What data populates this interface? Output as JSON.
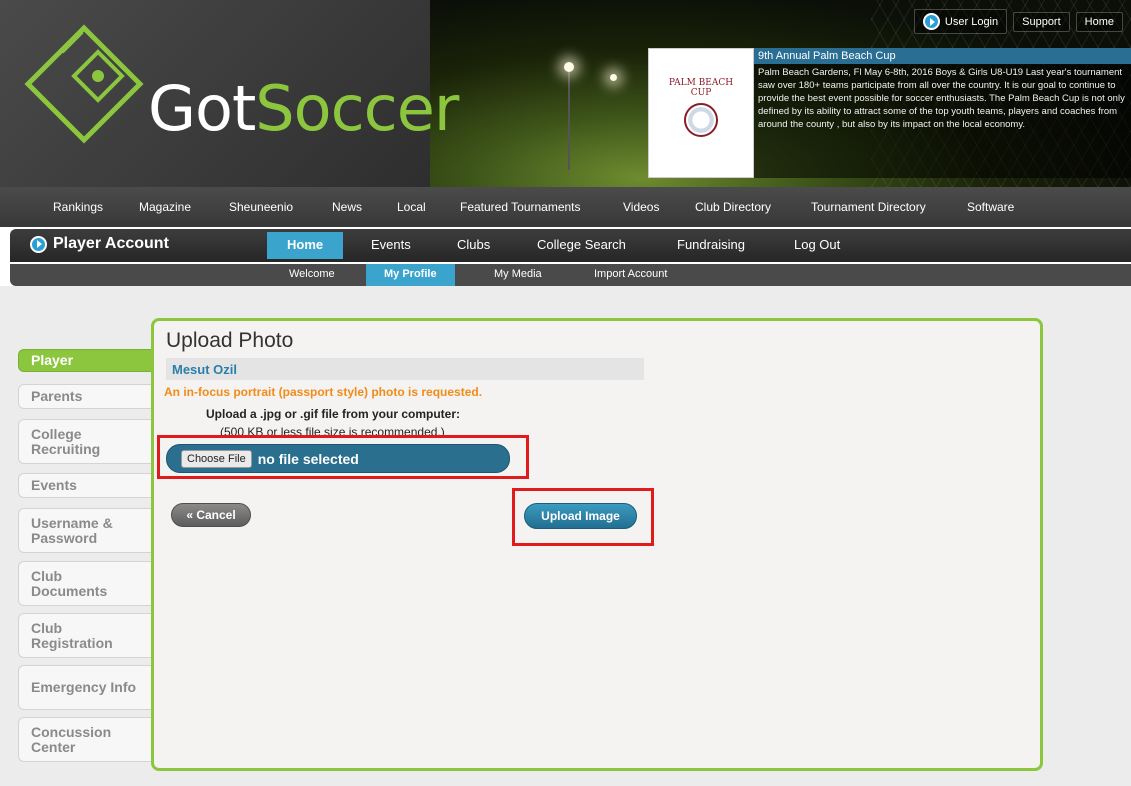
{
  "header": {
    "logo_got": "Got",
    "logo_soccer": "Soccer",
    "top_links": [
      "User Login",
      "Support",
      "Home"
    ]
  },
  "promo": {
    "logo_text_1": "PALM BEACH",
    "logo_text_2": "CUP",
    "title": "9th Annual Palm Beach Cup",
    "body": "Palm Beach Gardens, Fl May 6-8th, 2016 Boys & Girls U8-U19 Last year's tournament saw over 180+ teams participate from all over the country. It is our goal to continue to provide the best event possible for soccer enthusiasts. The Palm Beach Cup is not only defined by its ability to attract some of the top youth teams, players and coaches from around the county , but also by its impact on the local economy."
  },
  "main_nav": [
    "Rankings",
    "Magazine",
    "Sheuneenio",
    "News",
    "Local",
    "Featured Tournaments",
    "Videos",
    "Club Directory",
    "Tournament Directory",
    "Software"
  ],
  "account_nav": {
    "title": "Player Account",
    "items": [
      "Home",
      "Events",
      "Clubs",
      "College Search",
      "Fundraising",
      "Log Out"
    ],
    "active": "Home"
  },
  "sub_nav": {
    "items": [
      "Welcome",
      "My Profile",
      "My Media",
      "Import Account"
    ],
    "active": "My Profile"
  },
  "sidebar": {
    "items": [
      {
        "label": "Player",
        "active": true
      },
      {
        "label": "Parents",
        "active": false
      },
      {
        "label": "College Recruiting",
        "active": false
      },
      {
        "label": "Events",
        "active": false
      },
      {
        "label": "Username & Password",
        "active": false
      },
      {
        "label": "Club Documents",
        "active": false
      },
      {
        "label": "Club Registration",
        "active": false
      },
      {
        "label": "Emergency Info",
        "active": false
      },
      {
        "label": "Concussion Center",
        "active": false
      }
    ]
  },
  "upload": {
    "title": "Upload Photo",
    "player_name": "Mesut Ozil",
    "request_note": "An in-focus portrait (passport style) photo is requested.",
    "instructions": "Upload a .jpg or .gif file from your computer:",
    "size_note": "(500 KB or less file size is recommended.)",
    "choose_file_label": "Choose File",
    "file_status": "no file selected",
    "cancel_label": "« Cancel",
    "upload_label": "Upload Image"
  },
  "colors": {
    "brand_green": "#8cc63f",
    "accent_blue": "#3aa4cc",
    "highlight_red": "#e01b1b"
  }
}
